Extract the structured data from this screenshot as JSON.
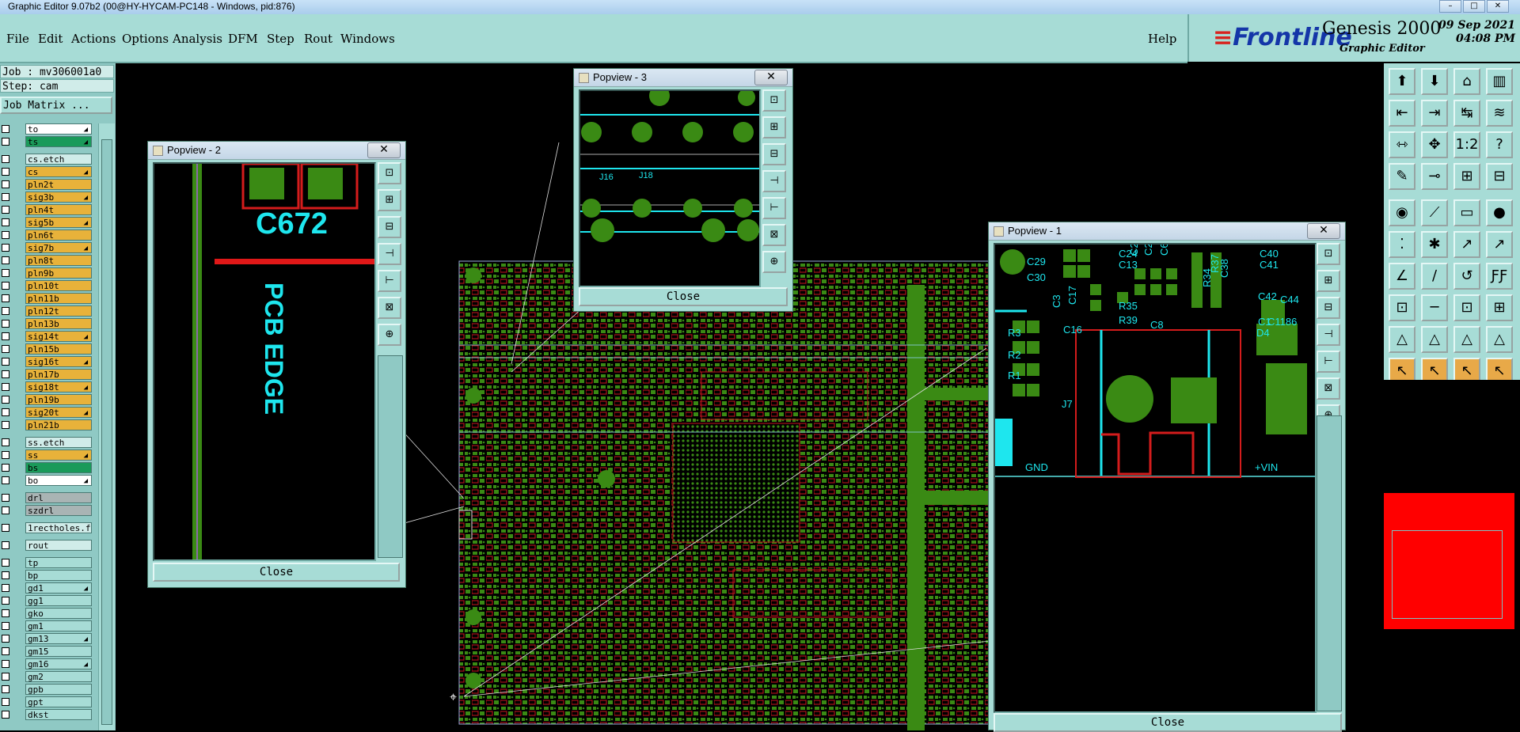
{
  "window": {
    "title": "Graphic Editor 9.07b2 (00@HY-HYCAM-PC148 - Windows, pid:876)",
    "min": "–",
    "max": "□",
    "close": "✕"
  },
  "menu": [
    "File",
    "Edit",
    "Actions",
    "Options",
    "Analysis",
    "DFM",
    "Step",
    "Rout",
    "Windows"
  ],
  "help_label": "Help",
  "logo": {
    "brand": "Frontline",
    "product": "Genesis 2000",
    "subtitle": "Graphic Editor",
    "date": "09 Sep 2021",
    "time": "04:08 PM"
  },
  "left_panel": {
    "job": "Job : mv306001a0",
    "step": "Step: cam",
    "job_matrix": "Job Matrix ..."
  },
  "layers": [
    {
      "name": "to",
      "color": "#ffffff",
      "arrow": "◢"
    },
    {
      "name": "ts",
      "color": "#1a9a5a",
      "arrow": "◢"
    },
    {
      "name": "cs.etch",
      "color": "#d0ece9",
      "arrow": ""
    },
    {
      "name": "cs",
      "color": "#e8b23a",
      "arrow": "◢"
    },
    {
      "name": "pln2t",
      "color": "#e8b23a",
      "arrow": ""
    },
    {
      "name": "sig3b",
      "color": "#e8b23a",
      "arrow": "◢"
    },
    {
      "name": "pln4t",
      "color": "#e8b23a",
      "arrow": ""
    },
    {
      "name": "sig5b",
      "color": "#e8b23a",
      "arrow": "◢"
    },
    {
      "name": "pln6t",
      "color": "#e8b23a",
      "arrow": ""
    },
    {
      "name": "sig7b",
      "color": "#e8b23a",
      "arrow": "◢"
    },
    {
      "name": "pln8t",
      "color": "#e8b23a",
      "arrow": ""
    },
    {
      "name": "pln9b",
      "color": "#e8b23a",
      "arrow": ""
    },
    {
      "name": "pln10t",
      "color": "#e8b23a",
      "arrow": ""
    },
    {
      "name": "pln11b",
      "color": "#e8b23a",
      "arrow": ""
    },
    {
      "name": "pln12t",
      "color": "#e8b23a",
      "arrow": ""
    },
    {
      "name": "pln13b",
      "color": "#e8b23a",
      "arrow": ""
    },
    {
      "name": "sig14t",
      "color": "#e8b23a",
      "arrow": "◢"
    },
    {
      "name": "pln15b",
      "color": "#e8b23a",
      "arrow": ""
    },
    {
      "name": "sig16t",
      "color": "#e8b23a",
      "arrow": "◢"
    },
    {
      "name": "pln17b",
      "color": "#e8b23a",
      "arrow": ""
    },
    {
      "name": "sig18t",
      "color": "#e8b23a",
      "arrow": "◢"
    },
    {
      "name": "pln19b",
      "color": "#e8b23a",
      "arrow": ""
    },
    {
      "name": "sig20t",
      "color": "#e8b23a",
      "arrow": "◢"
    },
    {
      "name": "pln21b",
      "color": "#e8b23a",
      "arrow": ""
    },
    {
      "name": "ss.etch",
      "color": "#d0ece9",
      "arrow": ""
    },
    {
      "name": "ss",
      "color": "#e8b23a",
      "arrow": "◢"
    },
    {
      "name": "bs",
      "color": "#1a9a5a",
      "arrow": ""
    },
    {
      "name": "bo",
      "color": "#ffffff",
      "arrow": "◢"
    },
    {
      "name": "drl",
      "color": "#a9b4b4",
      "arrow": ""
    },
    {
      "name": "szdrl",
      "color": "#a9b4b4",
      "arrow": ""
    },
    {
      "name": "1rectholes.f",
      "color": "#d0ece9",
      "arrow": ""
    },
    {
      "name": "rout",
      "color": "#d0ece9",
      "arrow": ""
    },
    {
      "name": "tp",
      "color": "#a7dcd6",
      "arrow": ""
    },
    {
      "name": "bp",
      "color": "#a7dcd6",
      "arrow": ""
    },
    {
      "name": "gd1",
      "color": "#a7dcd6",
      "arrow": "◢"
    },
    {
      "name": "gg1",
      "color": "#a7dcd6",
      "arrow": ""
    },
    {
      "name": "gko",
      "color": "#a7dcd6",
      "arrow": ""
    },
    {
      "name": "gm1",
      "color": "#a7dcd6",
      "arrow": ""
    },
    {
      "name": "gm13",
      "color": "#a7dcd6",
      "arrow": "◢"
    },
    {
      "name": "gm15",
      "color": "#a7dcd6",
      "arrow": ""
    },
    {
      "name": "gm16",
      "color": "#a7dcd6",
      "arrow": "◢"
    },
    {
      "name": "gm2",
      "color": "#a7dcd6",
      "arrow": ""
    },
    {
      "name": "gpb",
      "color": "#a7dcd6",
      "arrow": ""
    },
    {
      "name": "gpt",
      "color": "#a7dcd6",
      "arrow": ""
    },
    {
      "name": "dkst",
      "color": "#a7dcd6",
      "arrow": ""
    }
  ],
  "popups": {
    "p1": {
      "title": "Popview - 1",
      "close": "Close",
      "labels": [
        "C29",
        "C30",
        "C3",
        "C17",
        "C24",
        "C13",
        "C21",
        "C22",
        "C6",
        "R34",
        "R37",
        "C38",
        "C40",
        "C41",
        "C42",
        "C44",
        "C1",
        "C16",
        "R35",
        "R39",
        "C8",
        "C1186",
        "D4",
        "R3",
        "R2",
        "R1",
        "J7",
        "GND",
        "+VIN",
        "C"
      ]
    },
    "p2": {
      "title": "Popview - 2",
      "close": "Close",
      "labels": [
        "C672",
        "PCB EDGE"
      ]
    },
    "p3": {
      "title": "Popview - 3",
      "close": "Close",
      "labels": [
        "J16",
        "J18"
      ]
    }
  },
  "popup_close_glyph": "✕",
  "popup_tools": [
    "⊡",
    "⊞",
    "⊟",
    "⊣",
    "⊢",
    "⊠",
    "⊕"
  ],
  "right_tools": [
    "⬆",
    "⬇",
    "⌂",
    "▥",
    "⇤",
    "⇥",
    "↹",
    "≋",
    "⇿",
    "✥",
    "1:2",
    "?",
    "✎",
    "⊸",
    "⊞",
    "⊟",
    "◉",
    "⟋",
    "▭",
    "●",
    "⁚",
    "✱",
    "↗",
    "↗",
    "∠",
    "∕",
    "↺",
    "ƑƑ",
    "⊡",
    "─",
    "⊡",
    "⊞",
    "△",
    "△",
    "△",
    "△",
    "↖",
    "↖",
    "↖",
    "↖"
  ]
}
